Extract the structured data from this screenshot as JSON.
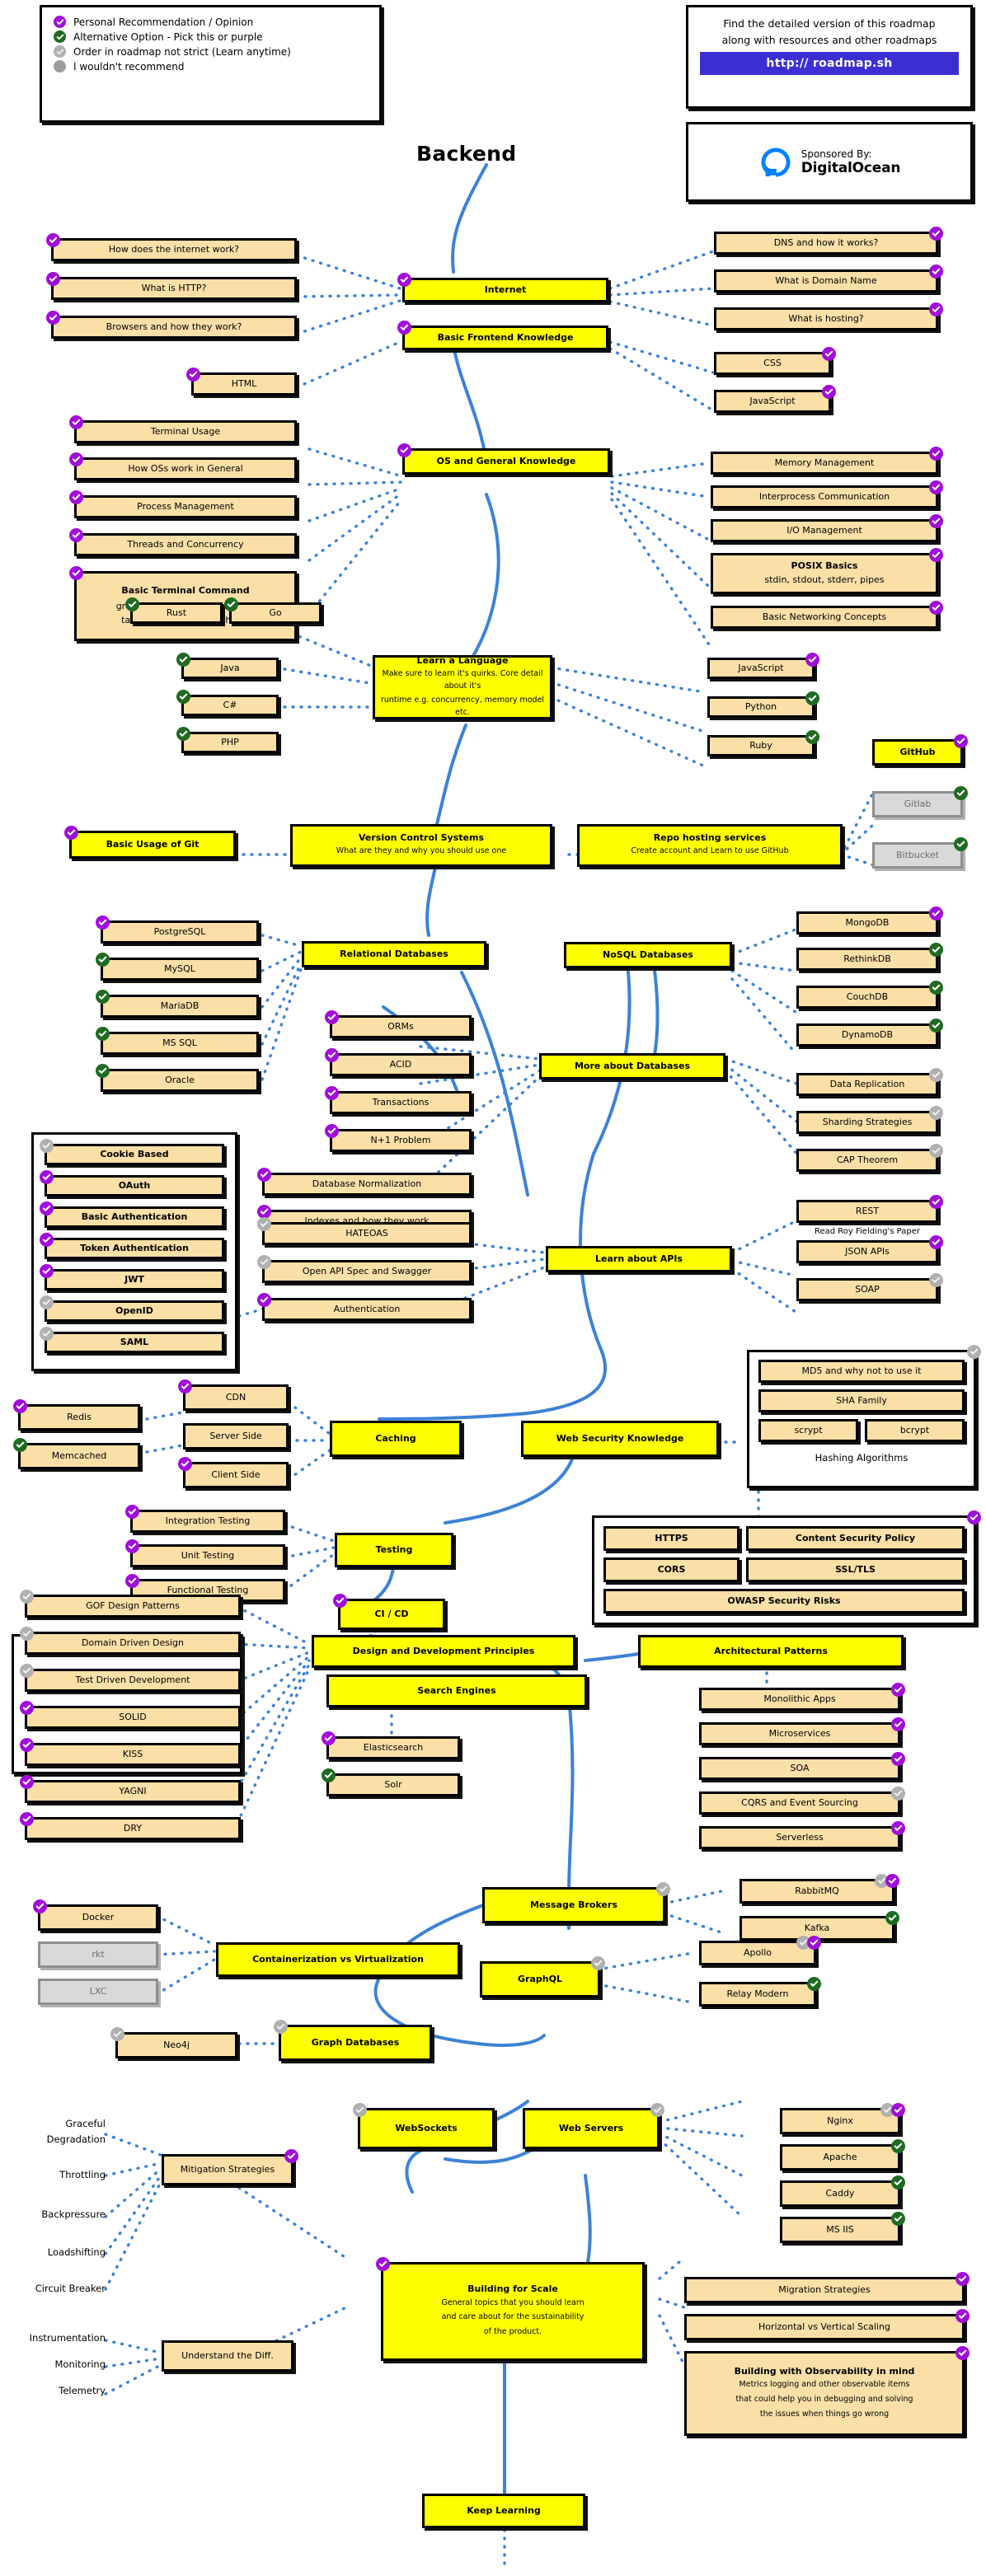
{
  "title": "Backend",
  "legend": {
    "items": [
      {
        "label": "Personal Recommendation / Opinion",
        "style": "purple"
      },
      {
        "label": "Alternative Option - Pick this or purple",
        "style": "green"
      },
      {
        "label": "Order in roadmap not strict (Learn anytime)",
        "style": "grey"
      },
      {
        "label": "I wouldn't recommend",
        "style": "plain"
      }
    ]
  },
  "promo": {
    "line1": "Find the detailed version of this roadmap",
    "line2": "along with resources and other roadmaps",
    "button": "http:// roadmap.sh"
  },
  "sponsor": {
    "prefix": "Sponsored By:",
    "name": "DigitalOcean"
  },
  "colors": {
    "beige": "#fadfa7",
    "yellow": "#ffff00",
    "grey": "#d9d9d9",
    "purple_badge": "#a10ed9",
    "green_badge": "#1f6b22",
    "grey_badge": "#b0b0b0",
    "wire": "#3d82d6",
    "promo_button": "#3b2fd4"
  },
  "nodes": {
    "internet": "Internet",
    "basic_frontend": "Basic Frontend Knowledge",
    "how_internet": "How does the internet work?",
    "what_http": "What is HTTP?",
    "browsers": "Browsers and how they work?",
    "html": "HTML",
    "dns": "DNS and how it works?",
    "domain_name": "What is Domain Name",
    "hosting": "What is hosting?",
    "css": "CSS",
    "javascript_front": "JavaScript",
    "os_general": "OS and General Knowledge",
    "terminal_usage": "Terminal Usage",
    "how_os": "How OSs work in General",
    "process_mgmt": "Process Management",
    "threads": "Threads and Concurrency",
    "basic_terminal_title": "Basic Terminal Command",
    "basic_terminal_line1": "grep, awk, sed, lsof, curl, wget",
    "basic_terminal_line2": "tail, head, less, find, ssh, kill",
    "memory_mgmt": "Memory Management",
    "ipc": "Interprocess Communication",
    "io_mgmt": "I/O Management",
    "posix_title": "POSIX Basics",
    "posix_sub": "stdin, stdout, stderr, pipes",
    "networking": "Basic Networking Concepts",
    "learn_lang_title": "Learn a Language",
    "learn_lang_sub1": "Make sure to learn it's quirks. Core detail about it's",
    "learn_lang_sub2": "runtime e.g. concurrency, memory model etc.",
    "rust": "Rust",
    "go": "Go",
    "java": "Java",
    "csharp": "C#",
    "php": "PHP",
    "javascript_lang": "JavaScript",
    "python": "Python",
    "ruby": "Ruby",
    "vcs_title": "Version Control Systems",
    "vcs_sub": "What are they and why you should use one",
    "basic_git": "Basic Usage of Git",
    "repo_hosting_title": "Repo hosting services",
    "repo_hosting_sub": "Create account and Learn to use GitHub",
    "github": "GitHub",
    "gitlab": "Gitlab",
    "bitbucket": "Bitbucket",
    "relational_db": "Relational Databases",
    "postgresql": "PostgreSQL",
    "mysql": "MySQL",
    "mariadb": "MariaDB",
    "mssql": "MS SQL",
    "oracle": "Oracle",
    "nosql_db": "NoSQL Databases",
    "mongodb": "MongoDB",
    "rethinkdb": "RethinkDB",
    "couchdb": "CouchDB",
    "dynamodb": "DynamoDB",
    "more_db": "More about Databases",
    "orms": "ORMs",
    "acid": "ACID",
    "transactions": "Transactions",
    "n1_problem": "N+1 Problem",
    "db_normalization": "Database Normalization",
    "indexes": "Indexes and how they work",
    "data_replication": "Data Replication",
    "sharding": "Sharding Strategies",
    "cap_theorem": "CAP Theorem",
    "learn_apis": "Learn about APIs",
    "hateoas": "HATEOAS",
    "openapi": "Open API Spec and Swagger",
    "authentication": "Authentication",
    "rest": "REST",
    "roy_fielding": "Read Roy Fielding's Paper",
    "json_apis": "JSON APIs",
    "soap": "SOAP",
    "cookie_based": "Cookie Based",
    "oauth": "OAuth",
    "basic_auth": "Basic Authentication",
    "token_auth": "Token Authentication",
    "jwt": "JWT",
    "openid": "OpenID",
    "saml": "SAML",
    "caching": "Caching",
    "cdn": "CDN",
    "server_side": "Server Side",
    "client_side": "Client Side",
    "redis": "Redis",
    "memcached": "Memcached",
    "web_security": "Web Security Knowledge",
    "md5": "MD5 and why not to use it",
    "sha_family": "SHA Family",
    "scrypt": "scrypt",
    "bcrypt": "bcrypt",
    "hashing_label": "Hashing Algorithms",
    "https": "HTTPS",
    "csp": "Content Security Policy",
    "cors": "CORS",
    "ssl_tls": "SSL/TLS",
    "owasp": "OWASP Security Risks",
    "testing": "Testing",
    "integration_testing": "Integration Testing",
    "unit_testing": "Unit Testing",
    "functional_testing": "Functional Testing",
    "cicd": "CI / CD",
    "design_principles": "Design and Development Principles",
    "gof": "GOF Design Patterns",
    "ddd": "Domain Driven Design",
    "tdd": "Test Driven Development",
    "solid": "SOLID",
    "kiss": "KISS",
    "yagni": "YAGNI",
    "dry": "DRY",
    "arch_patterns": "Architectural Patterns",
    "monolithic": "Monolithic Apps",
    "microservices": "Microservices",
    "soa": "SOA",
    "cqrs": "CQRS and Event Sourcing",
    "serverless": "Serverless",
    "search_engines": "Search Engines",
    "elasticsearch": "Elasticsearch",
    "solr": "Solr",
    "message_brokers": "Message Brokers",
    "rabbitmq": "RabbitMQ",
    "kafka": "Kafka",
    "containerization": "Containerization vs Virtualization",
    "docker": "Docker",
    "rkt": "rkt",
    "lxc": "LXC",
    "graphql": "GraphQL",
    "apollo": "Apollo",
    "relay_modern": "Relay Modern",
    "graph_db": "Graph Databases",
    "neo4j": "Neo4j",
    "websockets": "WebSockets",
    "web_servers": "Web Servers",
    "nginx": "Nginx",
    "apache": "Apache",
    "caddy": "Caddy",
    "msiis": "MS IIS",
    "mitigation": "Mitigation Strategies",
    "graceful_degradation": "Graceful\nDegradation",
    "throttling": "Throttling",
    "backpressure": "Backpressure",
    "loadshifting": "Loadshifting",
    "circuit_breaker": "Circuit Breaker",
    "understand_diff": "Understand the Diff.",
    "instrumentation": "Instrumentation",
    "monitoring": "Monitoring",
    "telemetry": "Telemetry",
    "scale_title": "Building for Scale",
    "scale_sub1": "General topics that you should learn",
    "scale_sub2": "and care about for the sustainability",
    "scale_sub3": "of the product.",
    "migration": "Migration Strategies",
    "horizontal_vertical": "Horizontal vs Vertical Scaling",
    "observability_title": "Building with Observability in mind",
    "observability_sub1": "Metrics logging and other observable items",
    "observability_sub2": "that could help you in debugging and solving",
    "observability_sub3": "the issues when things go wrong",
    "keep_learning": "Keep Learning"
  },
  "labels": {
    "graceful1": "Graceful",
    "graceful2": "Degradation"
  }
}
